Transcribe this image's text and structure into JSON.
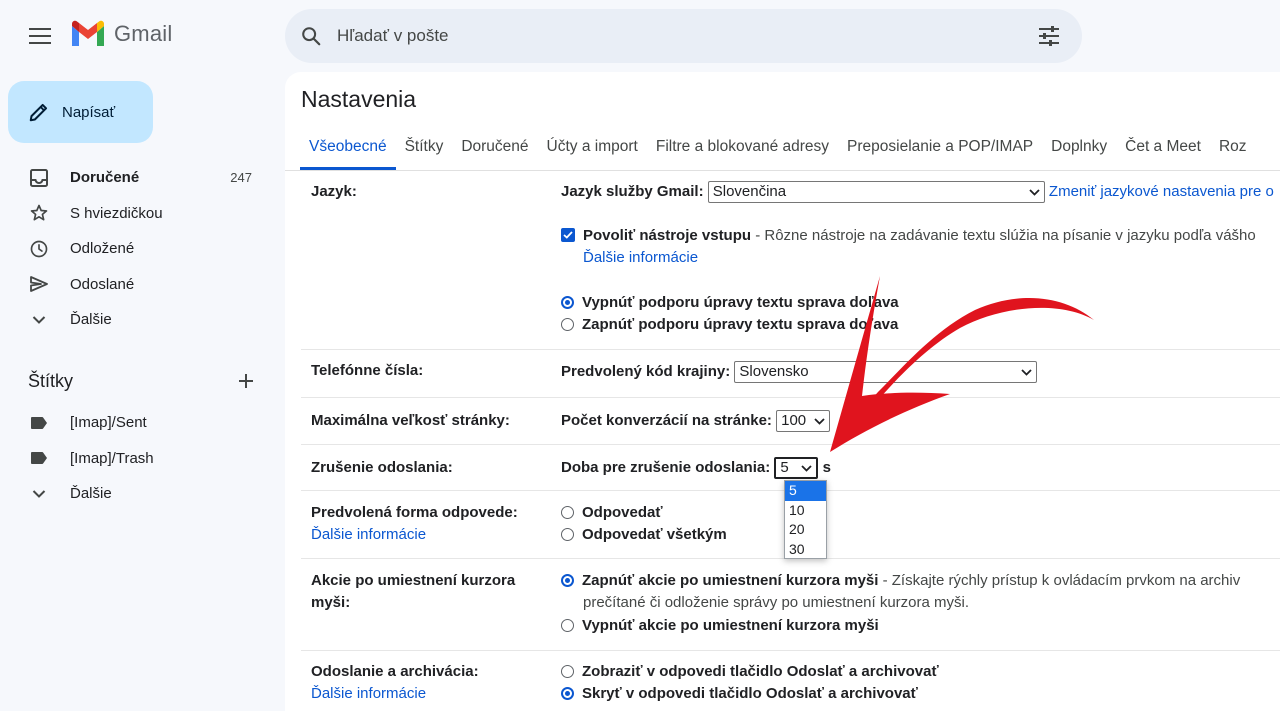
{
  "app": {
    "name": "Gmail"
  },
  "search": {
    "placeholder": "Hľadať v pošte"
  },
  "compose": {
    "label": "Napísať"
  },
  "nav": [
    {
      "label": "Doručené",
      "count": "247",
      "icon": "inbox-icon"
    },
    {
      "label": "S hviezdičkou",
      "count": "",
      "icon": "star-icon"
    },
    {
      "label": "Odložené",
      "count": "",
      "icon": "clock-icon"
    },
    {
      "label": "Odoslané",
      "count": "",
      "icon": "send-icon"
    },
    {
      "label": "Ďalšie",
      "count": "",
      "icon": "chevron-down-icon"
    }
  ],
  "labels": {
    "title": "Štítky",
    "items": [
      {
        "label": "[Imap]/Sent"
      },
      {
        "label": "[Imap]/Trash"
      },
      {
        "label": "Ďalšie"
      }
    ]
  },
  "settings": {
    "title": "Nastavenia",
    "tabs": [
      "Všeobecné",
      "Štítky",
      "Doručené",
      "Účty a import",
      "Filtre a blokované adresy",
      "Preposielanie a POP/IMAP",
      "Doplnky",
      "Čet a Meet",
      "Roz"
    ],
    "language": {
      "label": "Jazyk:",
      "field_label": "Jazyk služby Gmail:",
      "value": "Slovenčina",
      "change_link": "Zmeniť jazykové nastavenia pre o",
      "input_tools_title": "Povoliť nástroje vstupu",
      "input_tools_desc": " - Rôzne nástroje na zadávanie textu slúžia na písanie v jazyku podľa vášho",
      "more_info": "Ďalšie informácie",
      "rtl_off": "Vypnúť podporu úpravy textu sprava doľava",
      "rtl_on": "Zapnúť podporu úpravy textu sprava doľava"
    },
    "phone": {
      "label": "Telefónne čísla:",
      "field_label": "Predvolený kód krajiny:",
      "value": "Slovensko"
    },
    "page_size": {
      "label": "Maximálna veľkosť stránky:",
      "field_label": "Počet konverzácií na stránke:",
      "value": "100"
    },
    "undo_send": {
      "label": "Zrušenie odoslania:",
      "field_label": "Doba pre zrušenie odoslania:",
      "value": "5",
      "unit": "s",
      "options": [
        "5",
        "10",
        "20",
        "30"
      ]
    },
    "reply": {
      "label": "Predvolená forma odpovede:",
      "more_info": "Ďalšie informácie",
      "opt1": "Odpovedať",
      "opt2": "Odpovedať všetkým"
    },
    "hover": {
      "label_line1": "Akcie po umiestnení kurzora",
      "label_line2": "myši:",
      "on_title": "Zapnúť akcie po umiestnení kurzora myši",
      "on_desc": " - Získajte rýchly prístup k ovládacím prvkom na archiv",
      "on_desc2": "prečítané či odloženie správy po umiestnení kurzora myši.",
      "off_title": "Vypnúť akcie po umiestnení kurzora myši"
    },
    "send_archive": {
      "label": "Odoslanie a archivácia:",
      "more_info": "Ďalšie informácie",
      "show": "Zobraziť v odpovedi tlačidlo Odoslať a archivovať",
      "hide": "Skryť v odpovedi tlačidlo Odoslať a archivovať"
    }
  },
  "colors": {
    "accent": "#0b57d0",
    "compose_bg": "#c2e7ff",
    "arrow": "#e0141e"
  }
}
